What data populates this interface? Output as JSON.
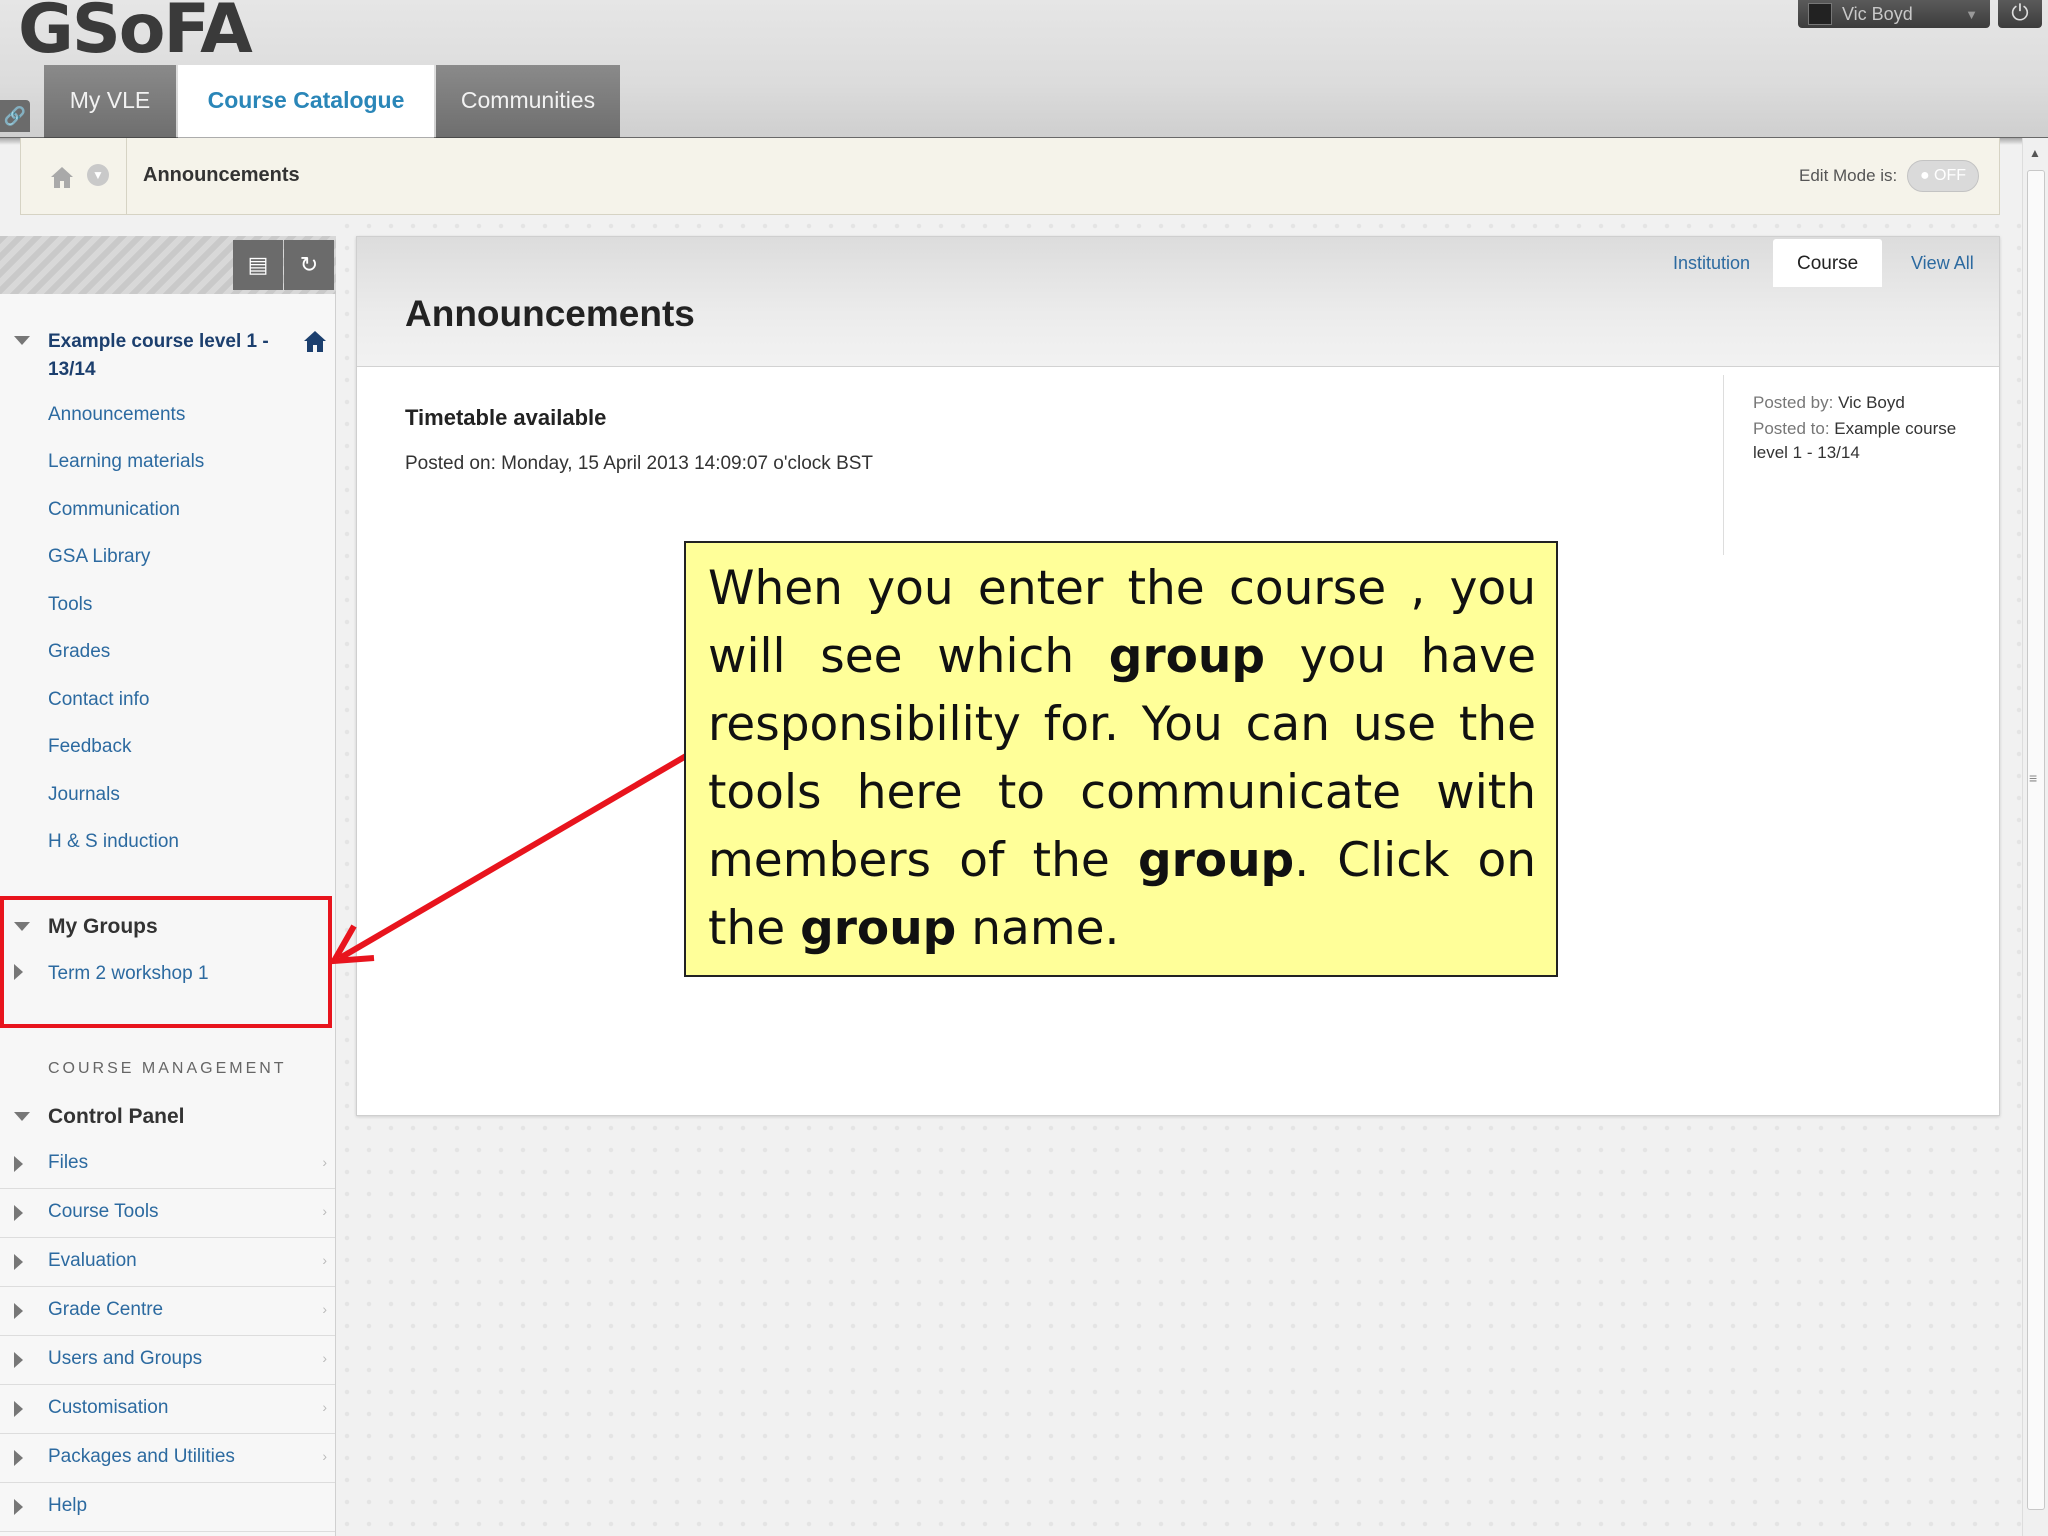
{
  "header": {
    "logo": "GSoFA",
    "user_name": "Vic Boyd",
    "tabs": [
      {
        "label": "My VLE",
        "active": false
      },
      {
        "label": "Course Catalogue",
        "active": true
      },
      {
        "label": "Communities",
        "active": false
      }
    ]
  },
  "breadcrumb": {
    "current": "Announcements",
    "edit_mode_label": "Edit Mode is:",
    "edit_mode_value": "OFF"
  },
  "sidebar": {
    "course_title": "Example course level 1 - 13/14",
    "menu_items": [
      "Announcements",
      "Learning materials",
      "Communication",
      "GSA Library",
      "Tools",
      "Grades",
      "Contact info",
      "Feedback",
      "Journals",
      "H & S induction"
    ],
    "my_groups": {
      "heading": "My Groups",
      "items": [
        "Term 2 workshop 1"
      ]
    },
    "course_management_label": "COURSE MANAGEMENT",
    "control_panel": {
      "heading": "Control Panel",
      "items": [
        "Files",
        "Course Tools",
        "Evaluation",
        "Grade Centre",
        "Users and Groups",
        "Customisation",
        "Packages and Utilities",
        "Help"
      ]
    }
  },
  "main": {
    "title": "Announcements",
    "filter_tabs": [
      {
        "label": "Institution",
        "active": false
      },
      {
        "label": "Course",
        "active": true
      },
      {
        "label": "View All",
        "active": false
      }
    ],
    "announcement": {
      "title": "Timetable available",
      "posted_on": "Posted on: Monday, 15 April 2013 14:09:07 o'clock BST",
      "posted_by_label": "Posted by:",
      "posted_by": "Vic Boyd",
      "posted_to_label": "Posted to:",
      "posted_to": "Example course level 1 - 13/14"
    }
  },
  "callout": {
    "parts": [
      "When you enter the course , you will see which ",
      "group",
      " you have responsibility for. You can use the tools here to communicate with members of the ",
      "group",
      ". Click on the ",
      "group",
      " name."
    ]
  },
  "colors": {
    "link": "#2c6aa0",
    "tab_active_text": "#2a86b8",
    "callout_bg": "#ffff99",
    "highlight_red": "#e8141d"
  }
}
